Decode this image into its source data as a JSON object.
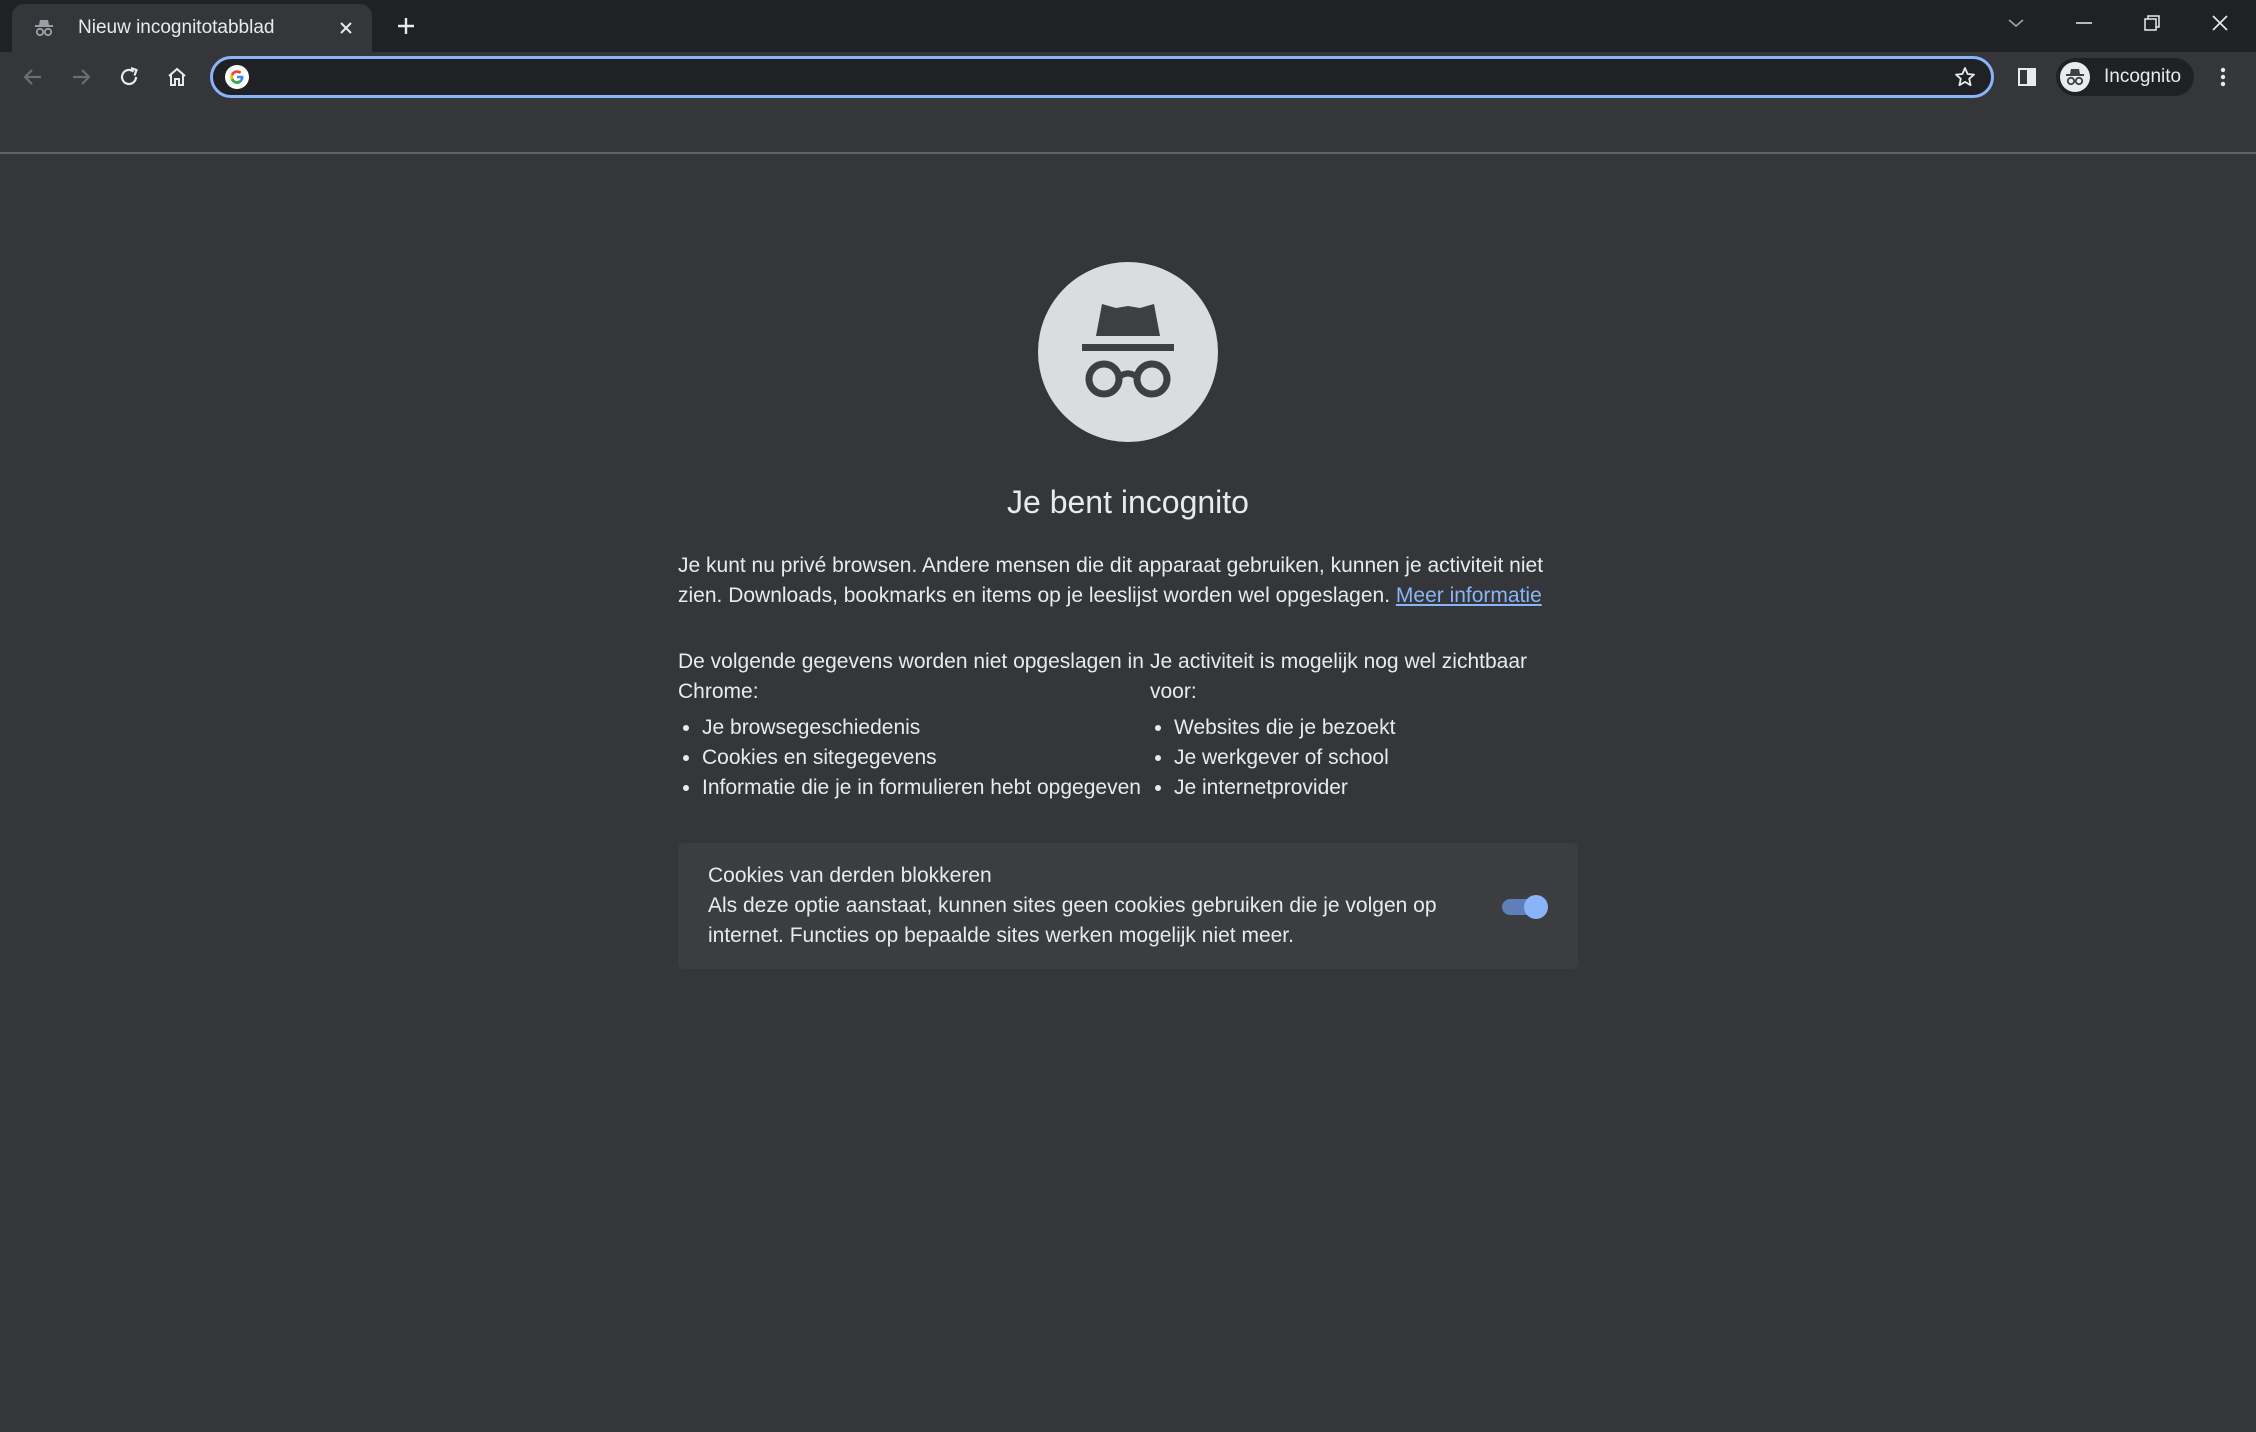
{
  "tab": {
    "title": "Nieuw incognitotabblad"
  },
  "toolbar": {
    "omnibox_value": "",
    "profile_label": "Incognito"
  },
  "content": {
    "heading": "Je bent incognito",
    "intro": "Je kunt nu privé browsen. Andere mensen die dit apparaat gebruiken, kunnen je activiteit niet zien. Downloads, bookmarks en items op je leeslijst worden wel opgeslagen.",
    "learn_more": "Meer informatie",
    "not_saved_title_a": "De volgende gegevens worden niet ",
    "not_saved_title_b": "opgeslagen",
    "not_saved_title_c": " in Chrome:",
    "not_saved_items": [
      "Je browsegeschiedenis",
      "Cookies en sitegegevens",
      "Informatie die je in formulieren hebt opgegeven"
    ],
    "visible_title_a": "Je activiteit is mogelijk ",
    "visible_title_b": "nog wel zichtbaar",
    "visible_title_c": " voor:",
    "visible_items": [
      "Websites die je bezoekt",
      "Je werkgever of school",
      "Je internetprovider"
    ]
  },
  "cookie_card": {
    "title": "Cookies van derden blokkeren",
    "description": "Als deze optie aanstaat, kunnen sites geen cookies gebruiken die je volgen op internet. Functies op bepaalde sites werken mogelijk niet meer.",
    "enabled": true
  },
  "colors": {
    "accent": "#8ab4f8",
    "background": "#35363a",
    "tabstrip": "#202124"
  },
  "icons": [
    "incognito-icon",
    "close-icon",
    "plus-icon",
    "chevron-down-icon",
    "minimize-icon",
    "restore-icon",
    "back-arrow-icon",
    "forward-arrow-icon",
    "reload-icon",
    "home-icon",
    "google-icon",
    "star-icon",
    "side-panel-icon",
    "more-vert-icon"
  ]
}
